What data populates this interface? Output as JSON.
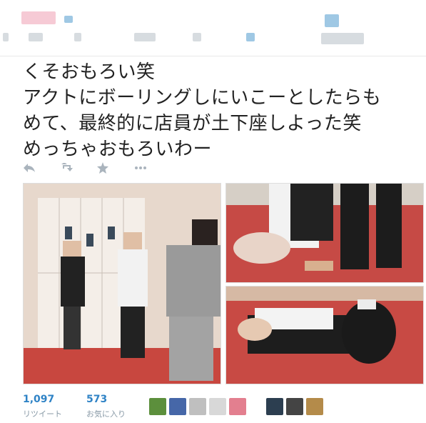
{
  "tweet": {
    "text": "くそおもろい笑\nアクトにボーリングしにいこーとしたらも\nめて、最終的に店員が土下座しよった笑\nめっちゃおもろいわー"
  },
  "actions": {
    "reply_icon": "reply-icon",
    "retweet_icon": "retweet-icon",
    "favorite_icon": "star-icon",
    "more_icon": "more-icon"
  },
  "stats": {
    "retweets": {
      "count": "1,097",
      "label": "リツイート"
    },
    "favorites": {
      "count": "573",
      "label": "お気に入り"
    }
  },
  "colors": {
    "accent": "#2f83c6",
    "muted": "#8899a6",
    "action_icon": "#aab4bd"
  }
}
